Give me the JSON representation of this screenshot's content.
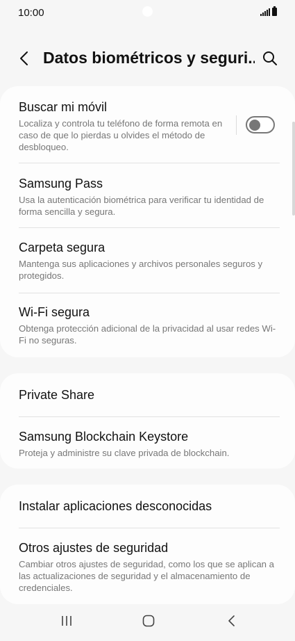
{
  "status_bar": {
    "time": "10:00",
    "icons": [
      "camera-dot",
      "signal-icon",
      "battery-icon"
    ]
  },
  "header": {
    "title": "Datos biométricos y seguri...",
    "back_icon": "back-chevron-icon",
    "search_icon": "search-icon"
  },
  "groups": [
    {
      "items": [
        {
          "title": "Buscar mi móvil",
          "description": "Localiza y controla tu teléfono de forma remota en caso de que lo pierdas u olvides el método de desbloqueo.",
          "toggle": {
            "state": "off"
          }
        },
        {
          "title": "Samsung Pass",
          "description": "Usa la autenticación biométrica para verificar tu identidad de forma sencilla y segura."
        },
        {
          "title": "Carpeta segura",
          "description": "Mantenga sus aplicaciones y archivos personales seguros y protegidos."
        },
        {
          "title": "Wi-Fi segura",
          "description": "Obtenga protección adicional de la privacidad al usar redes Wi-Fi no seguras."
        }
      ]
    },
    {
      "items": [
        {
          "title": "Private Share"
        },
        {
          "title": "Samsung Blockchain Keystore",
          "description": "Proteja y administre su clave privada de blockchain."
        }
      ]
    },
    {
      "items": [
        {
          "title": "Instalar aplicaciones desconocidas"
        },
        {
          "title": "Otros ajustes de seguridad",
          "description": "Cambiar otros ajustes de seguridad, como los que se aplican a las actualizaciones de seguridad y el almacenamiento de credenciales."
        }
      ]
    }
  ],
  "nav_bar": {
    "buttons": [
      "recent-apps-icon",
      "home-icon",
      "back-icon"
    ]
  },
  "colors": {
    "background": "#f6f6f6",
    "card": "#fdfdfd",
    "title_text": "#111111",
    "secondary_text": "#777777",
    "divider": "#e2e2e2",
    "toggle_off": "#777777"
  }
}
